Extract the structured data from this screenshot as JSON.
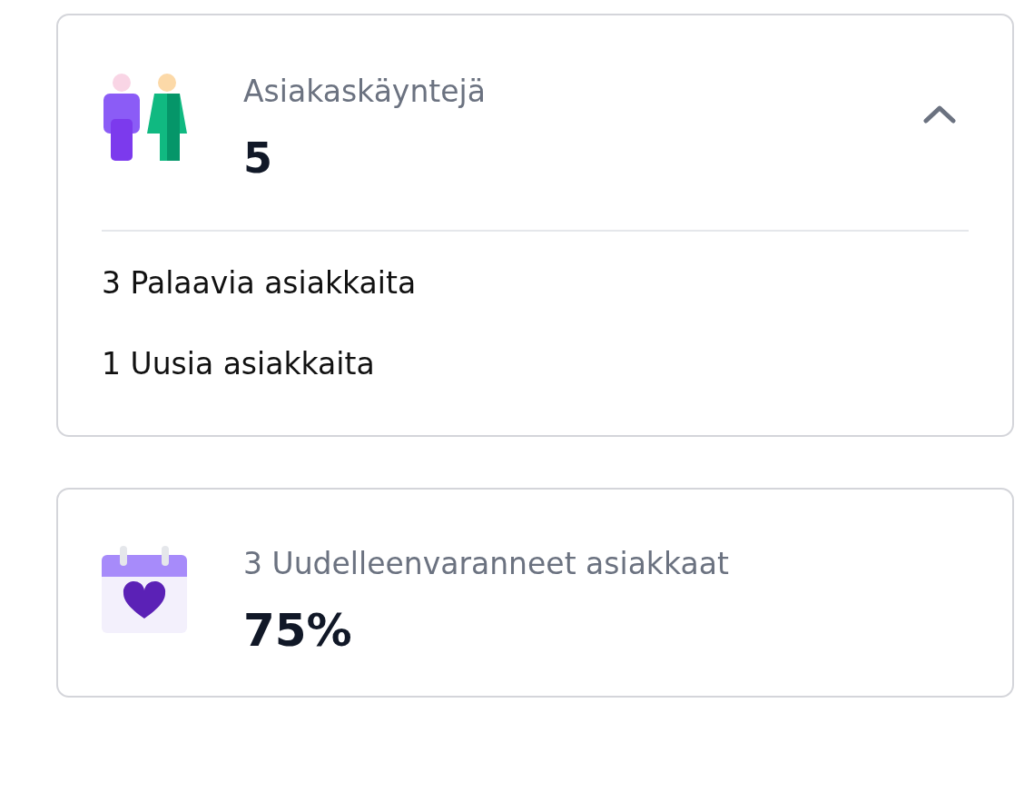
{
  "cards": [
    {
      "kind": "expandable",
      "title": "Asiakaskäyntejä",
      "value": "5",
      "expanded": true,
      "items": [
        "3 Palaavia asiakkaita",
        "1 Uusia asiakkaita"
      ]
    },
    {
      "kind": "plain",
      "title": "3 Uudelleenvaranneet asiakkaat",
      "value": "75%"
    }
  ]
}
